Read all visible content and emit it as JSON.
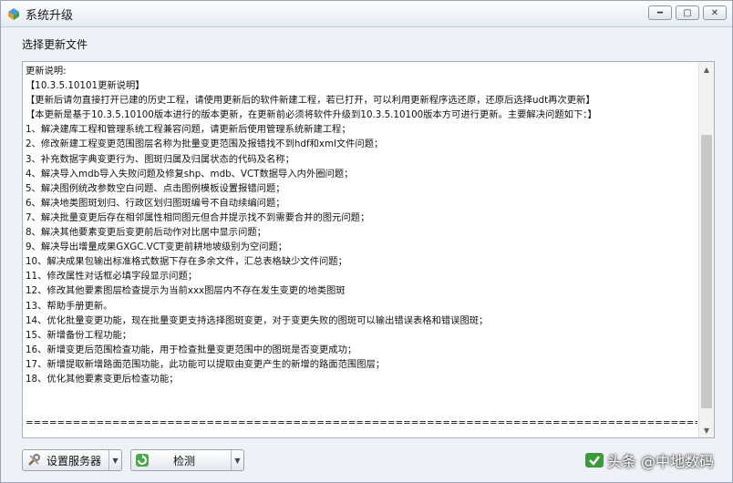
{
  "window": {
    "title": "系统升级"
  },
  "section": {
    "label": "选择更新文件"
  },
  "release_notes": {
    "lines": [
      "更新说明:",
      "【10.3.5.10101更新说明】",
      "【更新后请勿直接打开已建的历史工程，请使用更新后的软件新建工程，若已打开，可以利用更新程序选还原，还原后选择udt再次更新】",
      "【本更新是基于10.3.5.10100版本进行的版本更新，在更新前必须将软件升级到10.3.5.10100版本方可进行更新。主要解决问题如下：】",
      "1、解决建库工程和管理系统工程兼容问题，请更新后使用管理系统新建工程；",
      "2、修改新建工程变更范围图层名称为批量变更范围及报错找不到hdf和xml文件问题；",
      "3、补充数据字典变更行为、图斑归属及归属状态的代码及名称；",
      "4、解决导入mdb导入失败问题及修复shp、mdb、VCT数据导入内外圈问题；",
      "5、解决图例统改参数空白问题、点击图例模板设置报错问题；",
      "6、解决地类图斑划归、行政区划归图斑编号不自动续编问题；",
      "7、解决批量变更后存在相邻属性相同图元但合并提示找不到需要合并的图元问题；",
      "8、解决其他要素变更后变更前后动作对比居中显示问题；",
      "9、解决导出增量成果GXGC.VCT变更前耕地坡级别为空问题；",
      "10、解决成果包输出标准格式数据下存在多余文件，汇总表格缺少文件问题；",
      "11、修改属性对话框必填字段显示问题；",
      "12、修改其他要素图层检查提示为当前xxx图层内不存在发生变更的地类图斑",
      "13、帮助手册更新。",
      "14、优化批量变更功能，现在批量变更支持选择图斑变更，对于变更失败的图斑可以输出错误表格和错误图斑；",
      "15、新增备份工程功能；",
      "16、新增变更后范围检查功能，用于检查批量变更范围中的图斑是否变更成功；",
      "17、新增提取新增路面范围功能，此功能可以提取由变更产生的新增的路面范围图层；",
      "18、优化其他要素变更后检查功能；",
      "",
      "",
      "==========================================================================================="
    ]
  },
  "toolbar": {
    "settings_label": "设置服务器",
    "check_label": "检测"
  },
  "watermark": {
    "text": "头条 @中地数码"
  },
  "colors": {
    "accent_green": "#3a9a3a",
    "window_border": "#9aa6b8"
  }
}
